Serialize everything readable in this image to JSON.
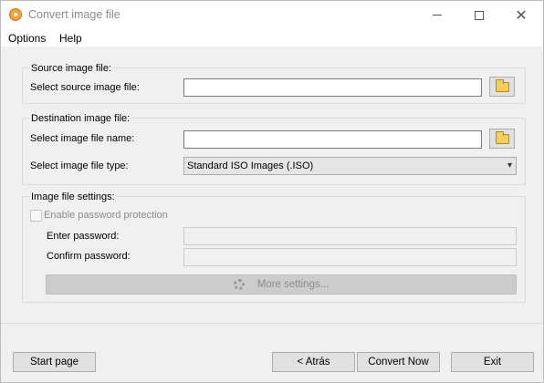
{
  "window": {
    "title": "Convert image file"
  },
  "menu": {
    "items": [
      "Options",
      "Help"
    ]
  },
  "source": {
    "group_title": "Source image file:",
    "file_label": "Select source image file:",
    "file_value": ""
  },
  "destination": {
    "group_title": "Destination image file:",
    "name_label": "Select image file name:",
    "name_value": "",
    "type_label": "Select image file type:",
    "type_value": "Standard ISO Images (.ISO)"
  },
  "settings": {
    "group_title": "Image file settings:",
    "password_checkbox_label": "Enable password protection",
    "password_checkbox_checked": false,
    "enter_password_label": "Enter password:",
    "confirm_password_label": "Confirm password:",
    "more_settings_label": "More settings..."
  },
  "footer": {
    "start_page_label": "Start page",
    "back_label": "< Atrás",
    "convert_label": "Convert Now",
    "exit_label": "Exit"
  }
}
